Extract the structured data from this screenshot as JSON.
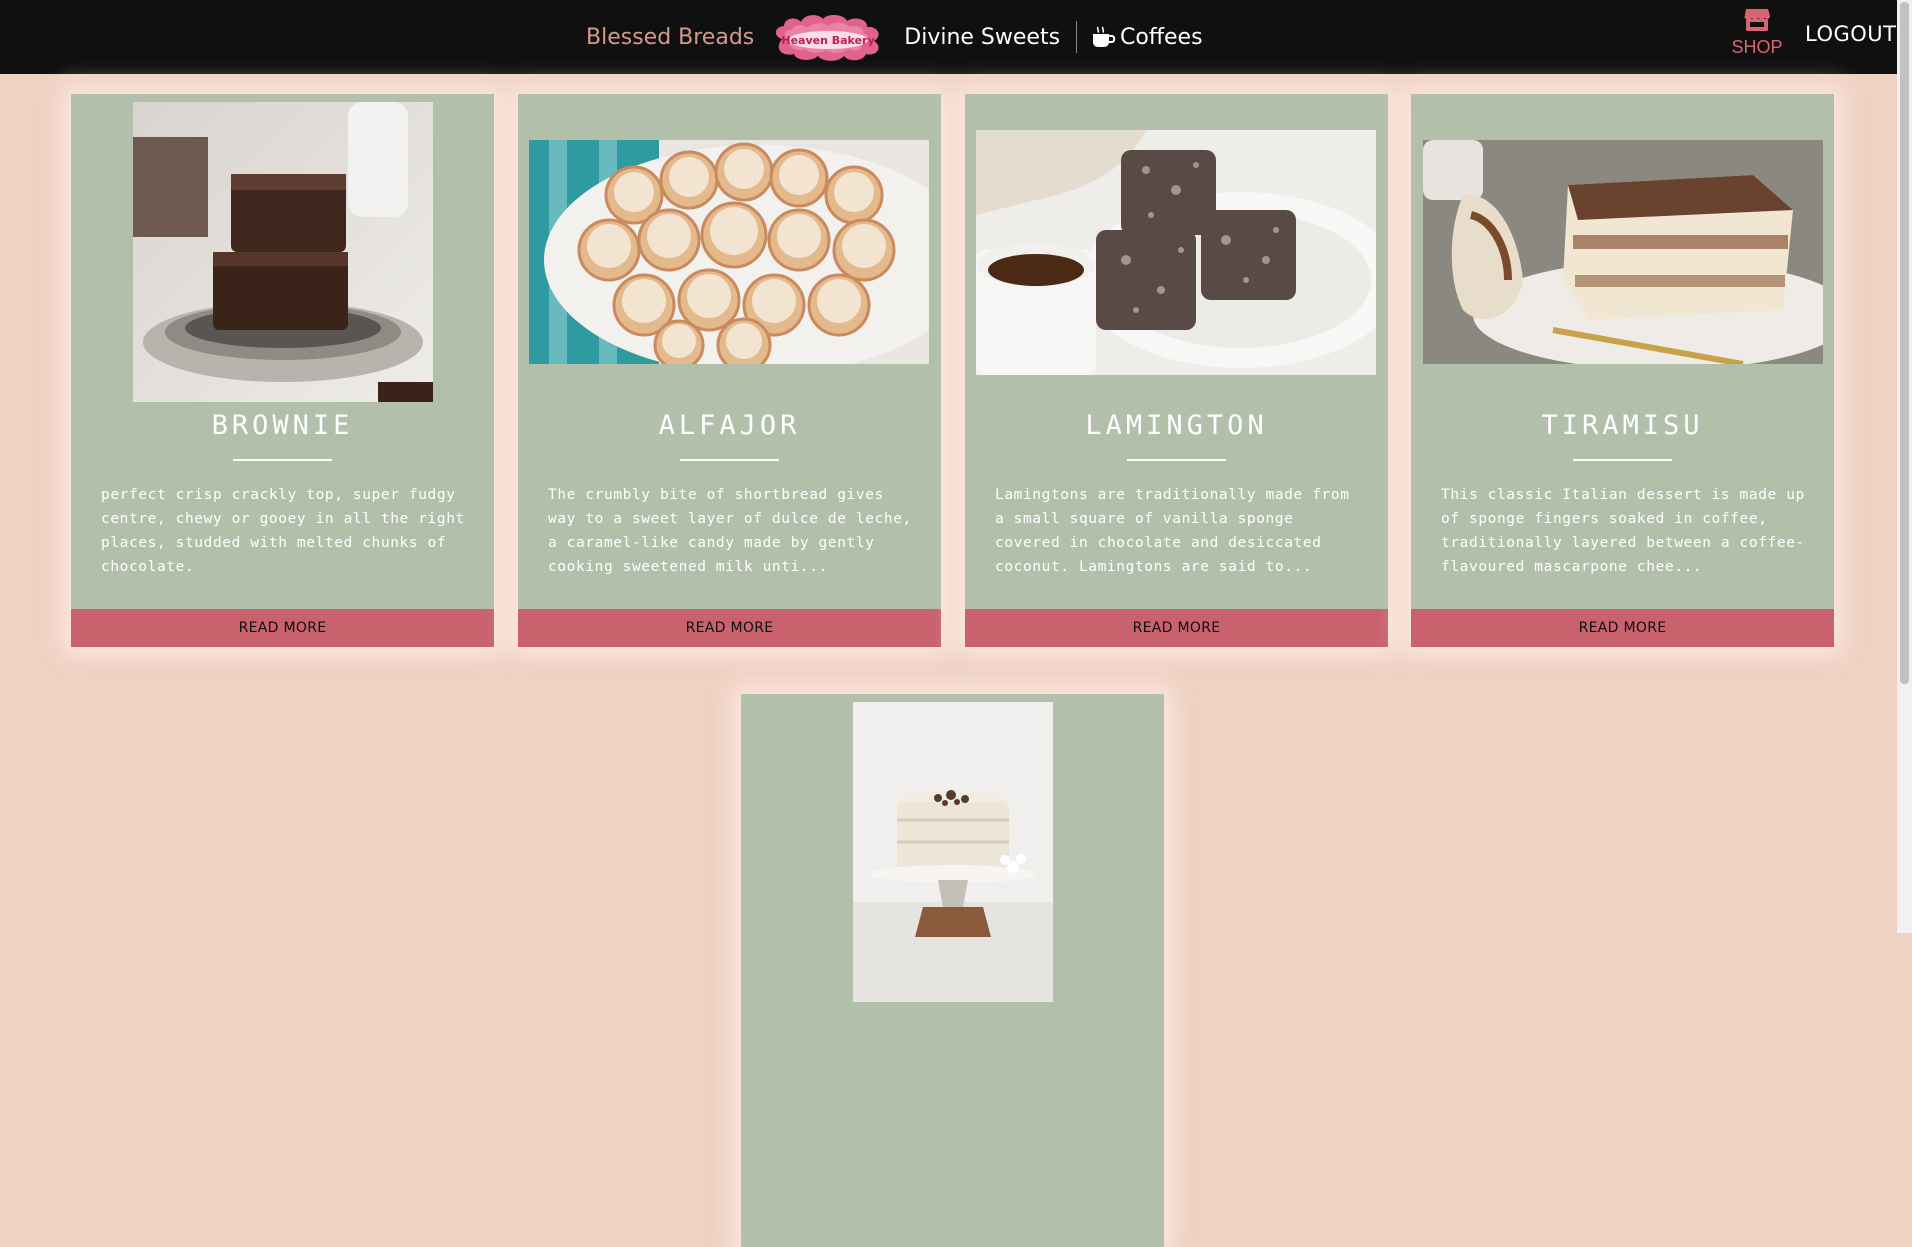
{
  "nav": {
    "links": [
      {
        "label": "Blessed Breads"
      },
      {
        "label": "Divine Sweets"
      },
      {
        "label": "Coffees"
      }
    ],
    "logo_text": "Heaven Bakery",
    "shop_label": "SHOP",
    "logout_label": "LOGOUT"
  },
  "colors": {
    "page_background": "#efd2c3",
    "navbar": "#101010",
    "card": "#b1bfab",
    "button": "#c9626d",
    "active_link": "#d59a8c",
    "shop_accent": "#d96474"
  },
  "cards": [
    {
      "title": "BROWNIE",
      "image": "brownie-photo",
      "description": "perfect crisp crackly top, super fudgy centre, chewy or gooey in all the right places, studded with melted chunks of chocolate.",
      "button_label": "READ MORE"
    },
    {
      "title": "ALFAJOR",
      "image": "alfajor-photo",
      "description": "The crumbly bite of shortbread gives way to a sweet layer of dulce de leche, a caramel-like candy made by gently cooking sweetened milk unti...",
      "button_label": "READ MORE"
    },
    {
      "title": "LAMINGTON",
      "image": "lamington-photo",
      "description": "Lamingtons are traditionally made from a small square of vanilla sponge covered in chocolate and desiccated coconut. Lamingtons are said to...",
      "button_label": "READ MORE"
    },
    {
      "title": "TIRAMISU",
      "image": "tiramisu-photo",
      "description": "This classic Italian dessert is made up of sponge fingers soaked in coffee, traditionally layered between a coffee-flavoured mascarpone chee...",
      "button_label": "READ MORE"
    },
    {
      "title": "",
      "image": "cake-photo",
      "description": "",
      "button_label": ""
    }
  ]
}
